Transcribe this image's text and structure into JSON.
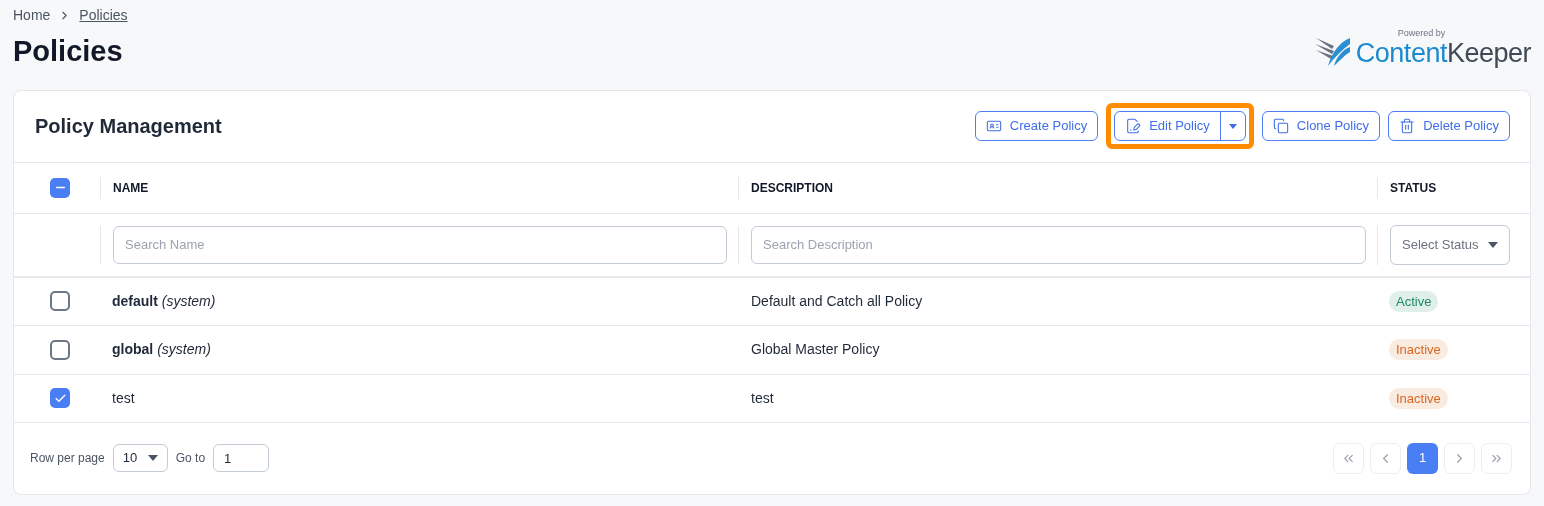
{
  "breadcrumb": [
    {
      "label": "Home",
      "current": false
    },
    {
      "label": "Policies",
      "current": true
    }
  ],
  "page_title": "Policies",
  "logo": {
    "tagline": "Powered by",
    "name_part_1": "Content",
    "name_part_2": "Keeper"
  },
  "card_title": "Policy Management",
  "actions": [
    {
      "kind": "create",
      "label": "Create Policy",
      "highlighted": false,
      "has_menu": false
    },
    {
      "kind": "edit",
      "label": "Edit Policy",
      "highlighted": true,
      "has_menu": true
    },
    {
      "kind": "clone",
      "label": "Clone Policy",
      "highlighted": false,
      "has_menu": false
    },
    {
      "kind": "delete",
      "label": "Delete Policy",
      "highlighted": false,
      "has_menu": false
    }
  ],
  "table": {
    "select_all": {
      "checked": true,
      "partial": true
    },
    "columns": [
      "NAME",
      "DESCRIPTION",
      "STATUS"
    ],
    "filters": {
      "name_placeholder": "Search Name",
      "description_placeholder": "Search Description",
      "status_placeholder": "Select Status"
    },
    "rows": [
      {
        "checked": false,
        "name": "**default** *(system)*",
        "description": "Default and Catch all Policy",
        "status": "Active",
        "color": "#1d8a62"
      },
      {
        "checked": false,
        "name": "**global** *(system)*",
        "description": "Global Master Policy",
        "status": "Inactive",
        "color": "#d9661f"
      },
      {
        "checked": true,
        "name": "test",
        "description": "test",
        "status": "Inactive",
        "color": "#d9661f"
      }
    ]
  },
  "footer": {
    "rows_label": "Row per page",
    "rows_value": "10",
    "goto_label": "Go to",
    "goto_value": "1",
    "pages": [
      {
        "label": "1",
        "selected": true
      }
    ]
  }
}
